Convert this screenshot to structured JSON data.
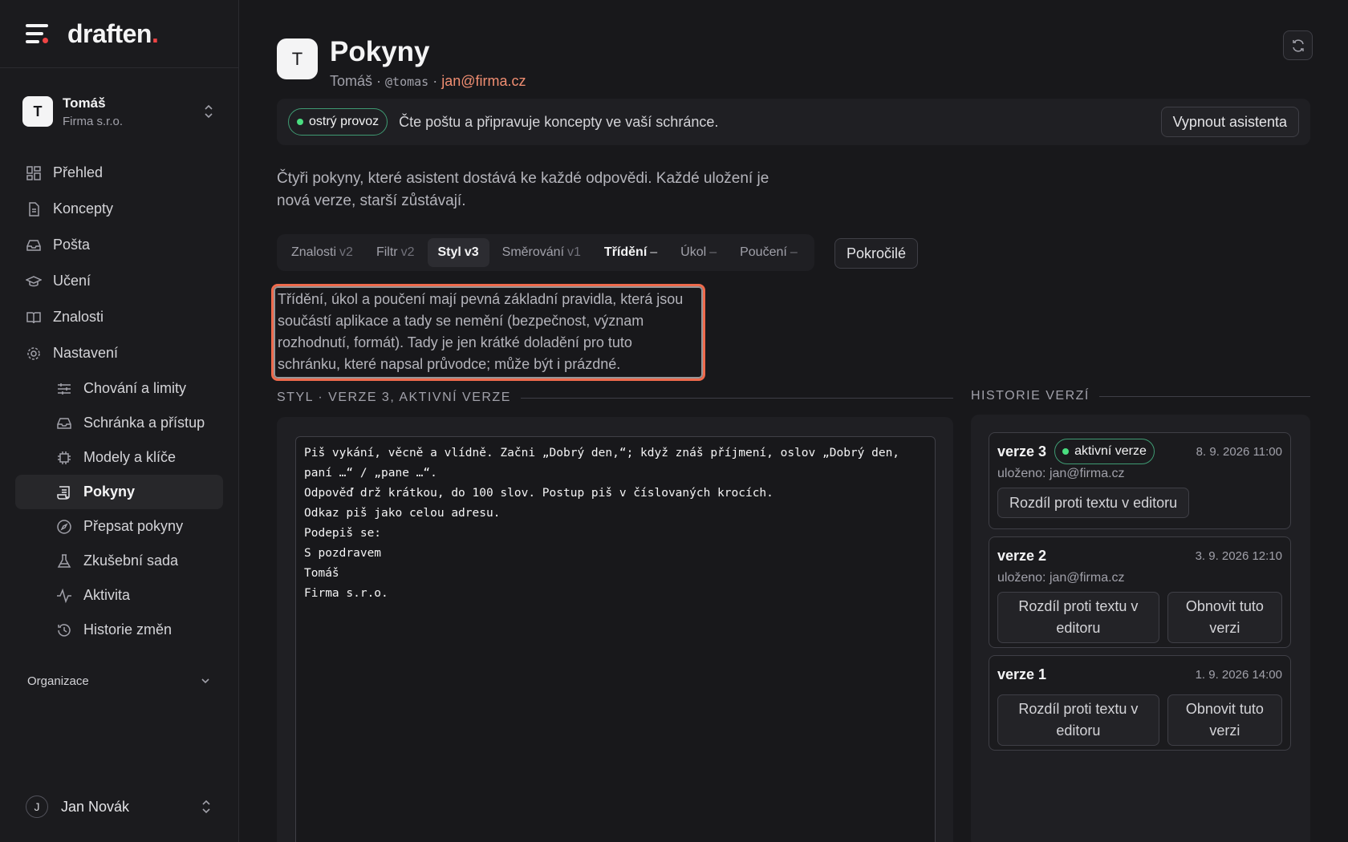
{
  "brand": {
    "name": "draften",
    "dot": "."
  },
  "account": {
    "initial": "T",
    "name": "Tomáš",
    "org": "Firma s.r.o."
  },
  "nav": {
    "items": [
      {
        "label": "Přehled",
        "icon": "grid-icon"
      },
      {
        "label": "Koncepty",
        "icon": "document-icon"
      },
      {
        "label": "Pošta",
        "icon": "inbox-icon"
      },
      {
        "label": "Učení",
        "icon": "graduation-cap-icon"
      },
      {
        "label": "Znalosti",
        "icon": "book-icon"
      },
      {
        "label": "Nastavení",
        "icon": "gear-icon"
      }
    ],
    "sub_items": [
      {
        "label": "Chování a limity",
        "icon": "sliders-icon"
      },
      {
        "label": "Schránka a přístup",
        "icon": "inbox-icon"
      },
      {
        "label": "Modely a klíče",
        "icon": "chip-icon"
      },
      {
        "label": "Pokyny",
        "icon": "scroll-icon",
        "active": true
      },
      {
        "label": "Přepsat pokyny",
        "icon": "compass-icon"
      },
      {
        "label": "Zkušební sada",
        "icon": "flask-icon"
      },
      {
        "label": "Aktivita",
        "icon": "activity-icon"
      },
      {
        "label": "Historie změn",
        "icon": "history-icon"
      }
    ],
    "org_label": "Organizace"
  },
  "user": {
    "initial": "J",
    "name": "Jan Novák"
  },
  "header": {
    "initial": "T",
    "title": "Pokyny",
    "name": "Tomáš",
    "sep1": " · ",
    "handle": "@tomas",
    "sep2": " · ",
    "email": "jan@firma.cz"
  },
  "status": {
    "badge": "ostrý provoz",
    "text": "Čte poštu a připravuje koncepty ve vaší schránce.",
    "button": "Vypnout asistenta"
  },
  "intro": "Čtyři pokyny, které asistent dostává ke každé odpovědi. Každé uložení je nová verze, starší zůstávají.",
  "tabs": [
    {
      "label": "Znalosti",
      "ver": "v2"
    },
    {
      "label": "Filtr",
      "ver": "v2"
    },
    {
      "label": "Styl",
      "ver": "v3",
      "active": true
    },
    {
      "label": "Směrování",
      "ver": "v1"
    },
    {
      "label": "Třídění",
      "ver": "–",
      "bold": true
    },
    {
      "label": "Úkol",
      "ver": "–"
    },
    {
      "label": "Poučení",
      "ver": "–"
    }
  ],
  "advanced_button": "Pokročilé",
  "note": "Třídění, úkol a poučení mají pevná základní pravidla, která jsou součástí aplikace a tady se nemění (bezpečnost, význam rozhodnutí, formát). Tady je jen krátké doladění pro tuto schránku, které napsal průvodce; může být i prázdné.",
  "editor_section": "STYL · VERZE 3, AKTIVNÍ VERZE",
  "editor_text": "Piš vykání, věcně a vlídně. Začni „Dobrý den,“; když znáš příjmení, oslov „Dobrý den, paní …“ / „pane …“.\nOdpověď drž krátkou, do 100 slov. Postup piš v číslovaných krocích.\nOdkaz piš jako celou adresu.\nPodepiš se:\nS pozdravem\nTomáš\nFirma s.r.o.",
  "history": {
    "title": "HISTORIE VERZÍ",
    "versions": [
      {
        "name": "verze 3",
        "badge": "aktivní verze",
        "date": "8. 9. 2026 11:00",
        "by": "uloženo: jan@firma.cz",
        "diff": "Rozdíl proti textu v editoru"
      },
      {
        "name": "verze 2",
        "date": "3. 9. 2026 12:10",
        "by": "uloženo: jan@firma.cz",
        "diff": "Rozdíl proti textu v editoru",
        "restore": "Obnovit tuto verzi"
      },
      {
        "name": "verze 1",
        "date": "1. 9. 2026 14:00",
        "diff": "Rozdíl proti textu v editoru",
        "restore": "Obnovit tuto verzi"
      }
    ]
  }
}
